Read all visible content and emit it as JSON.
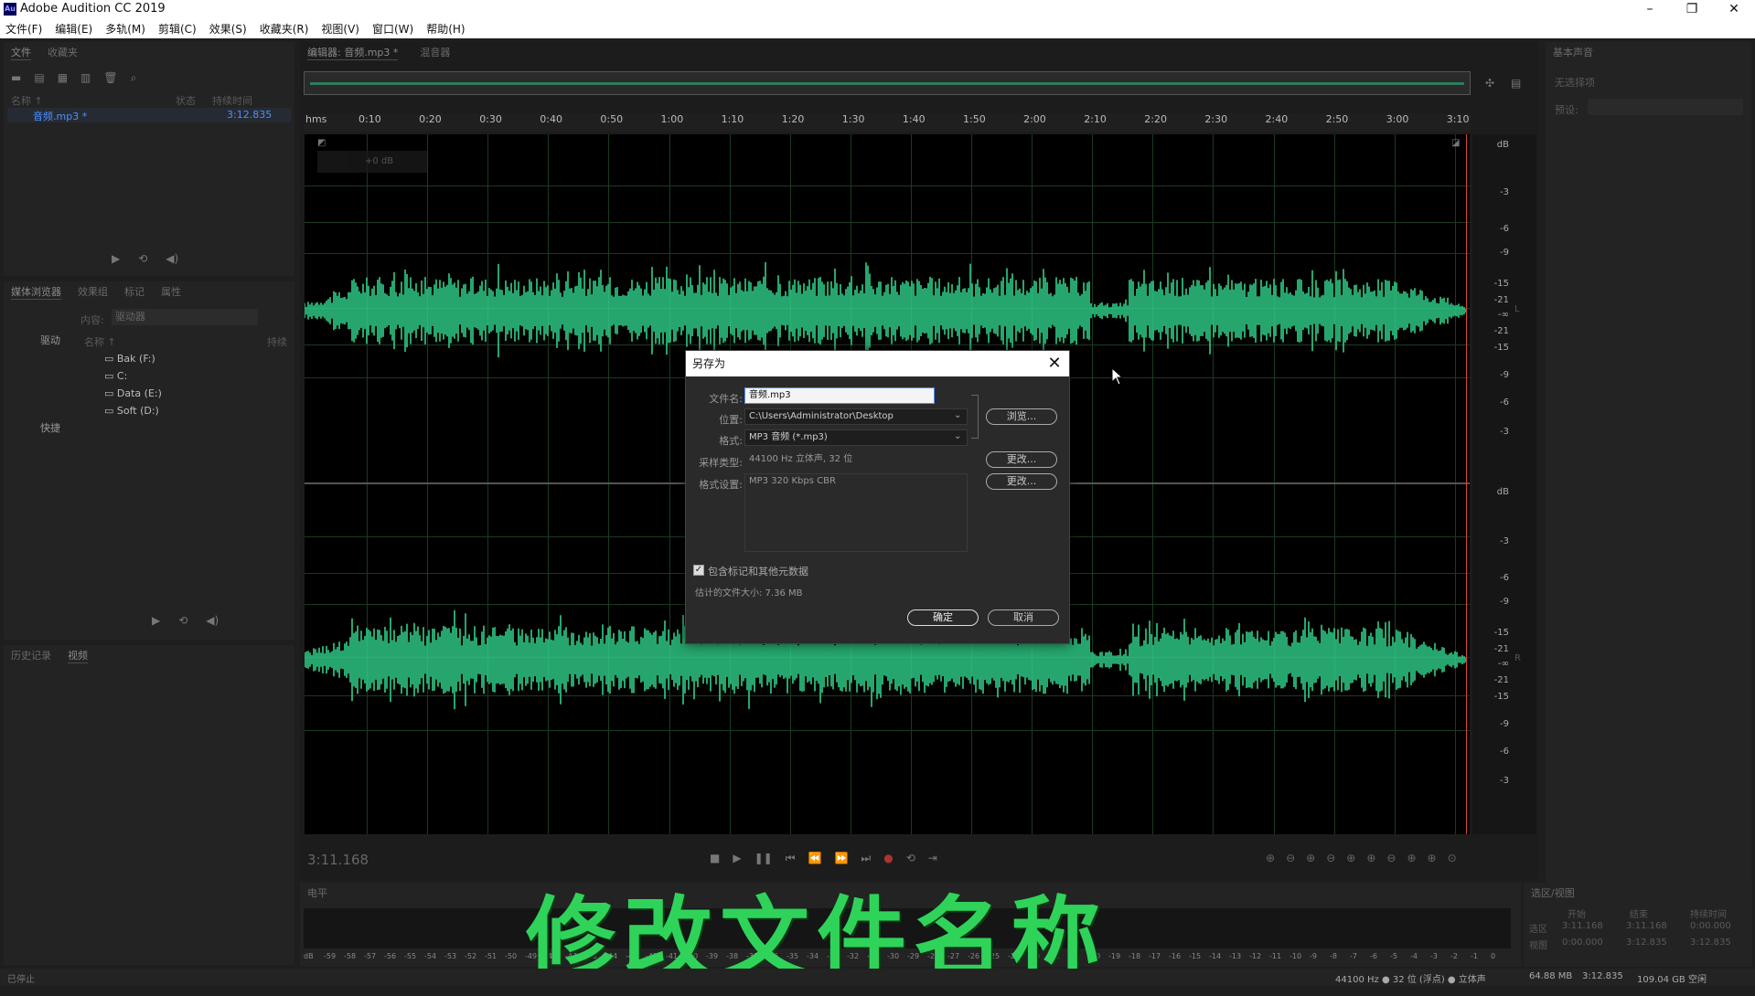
{
  "window": {
    "title": "Adobe Audition CC 2019",
    "logo": "Au"
  },
  "menu": [
    "文件(F)",
    "编辑(E)",
    "多轨(M)",
    "剪辑(C)",
    "效果(S)",
    "收藏夹(R)",
    "视图(V)",
    "窗口(W)",
    "帮助(H)"
  ],
  "files_panel": {
    "tabs": [
      "文件",
      "收藏夹"
    ],
    "columns": {
      "name": "名称 ↑",
      "status": "状态",
      "duration": "持续时间"
    },
    "items": [
      {
        "name": "音频.mp3 *",
        "duration": "3:12.835"
      }
    ]
  },
  "media_panel": {
    "tabs": [
      "媒体浏览器",
      "效果组",
      "标记",
      "属性"
    ],
    "content_label": "内容:",
    "content_value": "驱动器",
    "tree": [
      "驱动",
      "快捷"
    ],
    "list_header": "名称 ↑",
    "list_header_right": "持续",
    "drives": [
      "Bak (F:)",
      "C:",
      "Data (E:)",
      "Soft (D:)"
    ]
  },
  "history_panel": {
    "tabs": [
      "历史记录",
      "视频"
    ]
  },
  "editor": {
    "tabs": [
      "编辑器: 音频.mp3 *",
      "混音器"
    ],
    "ruler_unit": "hms",
    "ruler_ticks": [
      "0:10",
      "0:20",
      "0:30",
      "0:40",
      "0:50",
      "1:00",
      "1:10",
      "1:20",
      "1:30",
      "1:40",
      "1:50",
      "2:00",
      "2:10",
      "2:20",
      "2:30",
      "2:40",
      "2:50",
      "3:00",
      "3:10"
    ],
    "hud_gain": "+0 dB",
    "db_unit": "dB",
    "db_scale_top": [
      "-3",
      "-6",
      "-9",
      "-15",
      "-21",
      "-∞",
      "-21",
      "-15",
      "-9",
      "-6",
      "-3"
    ],
    "db_scale_bottom": [
      "-3",
      "-6",
      "-9",
      "-15",
      "-21",
      "-∞",
      "-21",
      "-15",
      "-9",
      "-6",
      "-3"
    ],
    "channel_top": "L",
    "channel_bottom": "R",
    "current_time": "3:11.168",
    "waveform_color": "#2fd08a"
  },
  "right_panel": {
    "title": "基本声音",
    "subtitle": "无选择项",
    "preset_label": "预设:"
  },
  "levels": {
    "title": "电平",
    "scale": [
      "dB",
      "-59",
      "-58",
      "-57",
      "-56",
      "-55",
      "-54",
      "-53",
      "-52",
      "-51",
      "-50",
      "-49",
      "-48",
      "-47",
      "-45",
      "-44",
      "-43",
      "-42",
      "-41",
      "-40",
      "-39",
      "-38",
      "-37",
      "-36",
      "-35",
      "-34",
      "-33",
      "-32",
      "-31",
      "-30",
      "-29",
      "-28",
      "-27",
      "-26",
      "-25",
      "-24",
      "-23",
      "-22",
      "-21",
      "-20",
      "-19",
      "-18",
      "-17",
      "-16",
      "-15",
      "-14",
      "-13",
      "-12",
      "-11",
      "-10",
      "-9",
      "-8",
      "-7",
      "-6",
      "-5",
      "-4",
      "-3",
      "-2",
      "-1",
      "0"
    ]
  },
  "selection_panel": {
    "title": "选区/视图",
    "headers": [
      "开始",
      "结束",
      "持续时间"
    ],
    "rows": [
      {
        "label": "选区",
        "start": "3:11.168",
        "end": "3:11.168",
        "dur": "0:00.000"
      },
      {
        "label": "视图",
        "start": "0:00.000",
        "end": "3:12.835",
        "dur": "3:12.835"
      }
    ]
  },
  "dialog": {
    "title": "另存为",
    "filename_label": "文件名:",
    "filename": "音频.mp3",
    "location_label": "位置:",
    "location": "C:\\Users\\Administrator\\Desktop",
    "browse": "浏览...",
    "format_label": "格式:",
    "format": "MP3 音频 (*.mp3)",
    "sample_label": "采样类型:",
    "sample": "44100 Hz 立体声, 32 位",
    "change1": "更改...",
    "format_settings_label": "格式设置:",
    "format_settings": "MP3 320 Kbps CBR",
    "change2": "更改...",
    "include_markers": "包含标记和其他元数据",
    "include_checked": true,
    "size_estimate": "估计的文件大小: 7.36 MB",
    "ok": "确定",
    "cancel": "取消"
  },
  "overlay_caption": "修改文件名称",
  "status": {
    "left": "已停止",
    "sample": "44100 Hz ● 32 位 (浮点) ● 立体声",
    "mem": "64.88 MB",
    "dur": "3:12.835",
    "free": "109.04 GB 空闲"
  }
}
